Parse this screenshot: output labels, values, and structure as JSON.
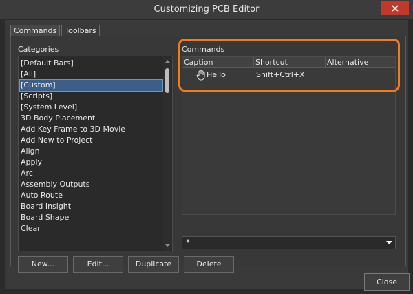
{
  "window": {
    "title": "Customizing PCB Editor"
  },
  "tabs": [
    {
      "label": "Commands",
      "active": true
    },
    {
      "label": "Toolbars",
      "active": false
    }
  ],
  "categories": {
    "label": "Categories",
    "items": [
      "[Default Bars]",
      "[All]",
      "[Custom]",
      "[Scripts]",
      "[System Level]",
      "3D Body Placement",
      "Add Key Frame to 3D Movie",
      "Add New to Project",
      "Align",
      "Apply",
      "Arc",
      "Assembly Outputs",
      "Auto Route",
      "Board Insight",
      "Board Shape",
      "Clear"
    ],
    "selected_index": 2
  },
  "commands": {
    "label": "Commands",
    "columns": [
      "Caption",
      "Shortcut",
      "Alternative"
    ],
    "rows": [
      {
        "icon": "hand-icon",
        "caption": "Hello",
        "shortcut": "Shift+Ctrl+X",
        "alternative": ""
      }
    ]
  },
  "filter": {
    "value": "*"
  },
  "buttons": {
    "new": "New...",
    "edit": "Edit...",
    "duplicate": "Duplicate",
    "delete": "Delete",
    "close": "Close"
  },
  "colors": {
    "highlight": "#f07d1a",
    "selection": "#3b5f8a",
    "close_accent": "#c0392b"
  }
}
